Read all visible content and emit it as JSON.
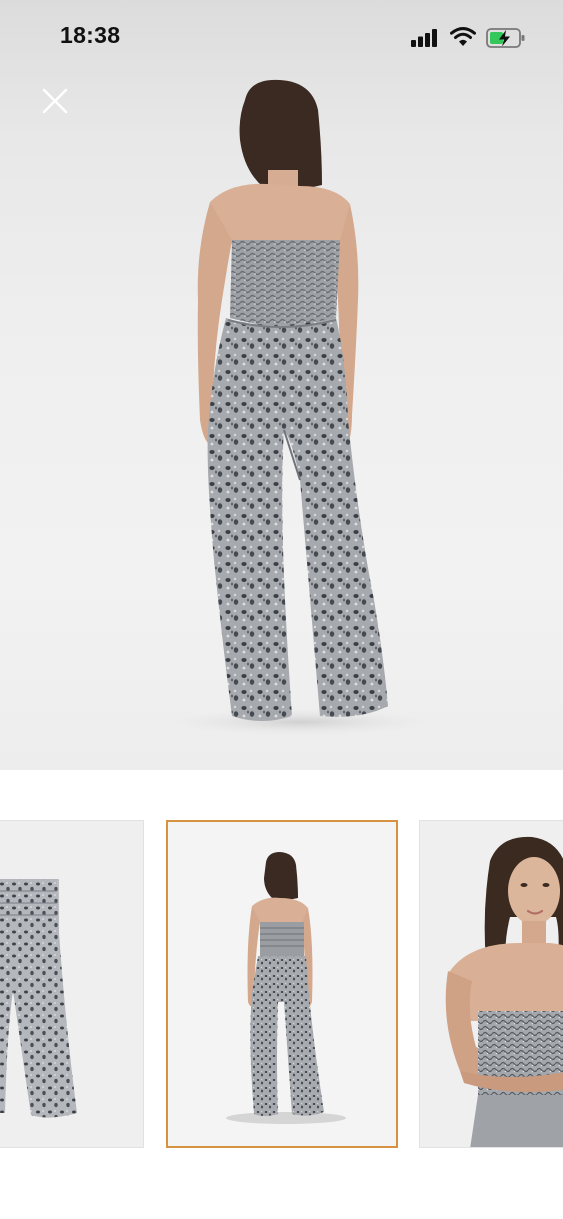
{
  "status_bar": {
    "time": "18:38",
    "icons": [
      "signal-icon",
      "wifi-icon",
      "battery-charging-icon"
    ],
    "battery_color": "#34c759"
  },
  "viewer": {
    "close_icon": "close-icon",
    "main_image": "jumpsuit-back-view",
    "thumbnails": [
      {
        "name": "thumb-flat-product",
        "selected": false
      },
      {
        "name": "thumb-back-view",
        "selected": true
      },
      {
        "name": "thumb-front-closeup",
        "selected": false
      }
    ],
    "selected_color": "#d7923f"
  }
}
